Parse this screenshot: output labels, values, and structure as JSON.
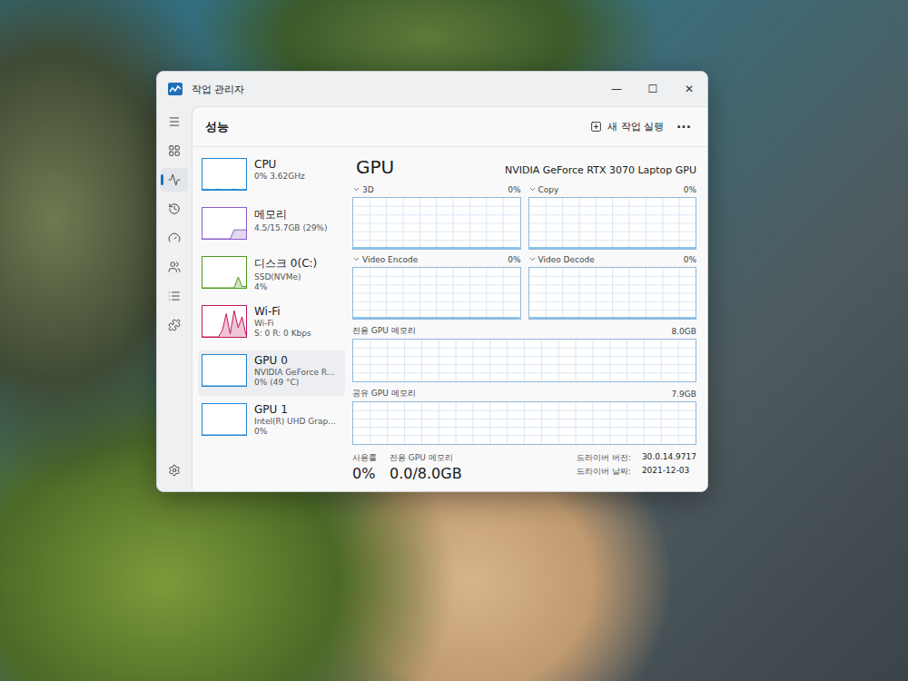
{
  "window": {
    "title": "작업 관리자",
    "controls": [
      "—",
      "☐",
      "✕"
    ]
  },
  "nav": [
    {
      "selected": false
    },
    {
      "selected": false
    },
    {
      "selected": true
    },
    {
      "selected": false
    },
    {
      "selected": false
    },
    {
      "selected": false
    },
    {
      "selected": false
    },
    {
      "selected": false
    },
    {
      "selected": false
    }
  ],
  "page": {
    "title": "성능",
    "run_task": "새 작업 실행",
    "more": "···"
  },
  "devices": [
    {
      "name": "CPU",
      "lines": [
        "0% 3.62GHz"
      ],
      "selected": false,
      "color": "#1f83d1",
      "series": [
        1,
        2,
        1,
        1,
        2,
        1,
        1,
        1,
        2,
        1,
        1,
        1
      ]
    },
    {
      "name": "메모리",
      "lines": [
        "4.5/15.7GB (29%)"
      ],
      "selected": false,
      "color": "#8a5cc9",
      "series": [
        0,
        0,
        0,
        0,
        0,
        0,
        0,
        0,
        29,
        29,
        29,
        29
      ]
    },
    {
      "name": "디스크 0(C:)",
      "lines": [
        "SSD(NVMe)",
        "4%"
      ],
      "selected": false,
      "color": "#4d9a1c",
      "series": [
        0,
        0,
        0,
        0,
        0,
        0,
        0,
        0,
        0,
        35,
        4,
        4
      ]
    },
    {
      "name": "Wi-Fi",
      "lines": [
        "Wi-Fi",
        "S: 0 R: 0 Kbps"
      ],
      "selected": false,
      "color": "#c2185b",
      "series": [
        0,
        0,
        0,
        0,
        0,
        20,
        75,
        10,
        85,
        30,
        65,
        5
      ]
    },
    {
      "name": "GPU 0",
      "lines": [
        "NVIDIA GeForce R...",
        "0% (49 °C)"
      ],
      "selected": true,
      "color": "#1f83d1",
      "series": [
        0,
        0,
        0,
        0,
        0,
        0,
        0,
        0,
        0,
        0,
        0,
        0
      ]
    },
    {
      "name": "GPU 1",
      "lines": [
        "Intel(R) UHD Grap...",
        "0%"
      ],
      "selected": false,
      "color": "#1f83d1",
      "series": [
        0,
        0,
        0,
        0,
        0,
        0,
        0,
        0,
        0,
        0,
        0,
        0
      ]
    }
  ],
  "gpu": {
    "title": "GPU",
    "model": "NVIDIA GeForce RTX 3070 Laptop GPU",
    "engines": [
      {
        "label": "3D",
        "percent": "0%",
        "values": [
          0,
          0,
          0,
          0,
          0,
          0,
          0,
          0,
          0,
          0
        ]
      },
      {
        "label": "Copy",
        "percent": "0%",
        "values": [
          0,
          0,
          0,
          0,
          0,
          0,
          0,
          0,
          0,
          0
        ]
      },
      {
        "label": "Video Encode",
        "percent": "0%",
        "values": [
          0,
          0,
          0,
          0,
          0,
          0,
          0,
          0,
          0,
          0
        ]
      },
      {
        "label": "Video Decode",
        "percent": "0%",
        "values": [
          0,
          0,
          0,
          0,
          0,
          0,
          0,
          0,
          0,
          0
        ]
      }
    ],
    "memory": [
      {
        "label": "전용 GPU 메모리",
        "capacity": "8.0GB",
        "level": 0
      },
      {
        "label": "공유 GPU 메모리",
        "capacity": "7.9GB",
        "level": 0
      }
    ],
    "stats": [
      {
        "label": "사용률",
        "value": "0%"
      },
      {
        "label": "전용 GPU 메모리",
        "value": "0.0/8.0GB"
      }
    ],
    "info": [
      {
        "label": "드라이버 버전:",
        "value": "30.0.14.9717"
      },
      {
        "label": "드라이버 날짜:",
        "value": "2021-12-03"
      }
    ]
  }
}
